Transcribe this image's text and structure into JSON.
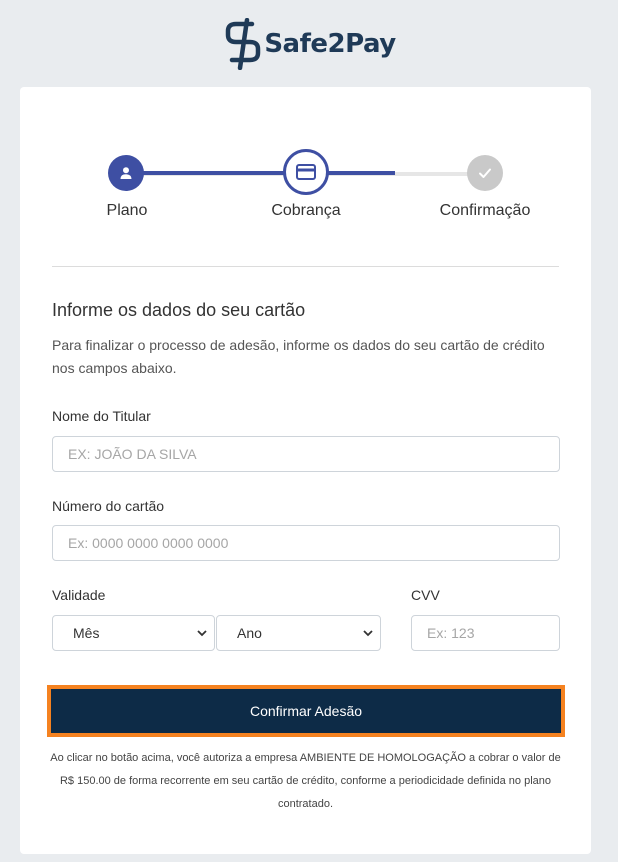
{
  "brand": {
    "name": "Safe2Pay"
  },
  "stepper": {
    "steps": [
      {
        "label": "Plano",
        "state": "completed",
        "icon": "user-icon"
      },
      {
        "label": "Cobrança",
        "state": "active",
        "icon": "credit-card-icon"
      },
      {
        "label": "Confirmação",
        "state": "pending",
        "icon": "check-icon"
      }
    ]
  },
  "form": {
    "title": "Informe os dados do seu cartão",
    "description": "Para finalizar o processo de adesão, informe os dados do seu cartão de crédito nos campos abaixo.",
    "holder_label": "Nome do Titular",
    "holder_placeholder": "EX: JOÃO DA SILVA",
    "card_number_label": "Número do cartão",
    "card_number_placeholder": "Ex: 0000 0000 0000 0000",
    "expiry_label": "Validade",
    "month_value": "Mês",
    "year_value": "Ano",
    "cvv_label": "CVV",
    "cvv_placeholder": "Ex: 123",
    "submit_label": "Confirmar Adesão"
  },
  "legal_text": "Ao clicar no botão acima, você autoriza a empresa AMBIENTE DE HOMOLOGAÇÃO a cobrar o valor de R$ 150.00 de forma recorrente em seu cartão de crédito, conforme a periodicidade definida no plano contratado.",
  "colors": {
    "primary": "#3e4fa3",
    "button": "#0d2b47",
    "highlight": "#f58220",
    "pending": "#c9c9c9"
  }
}
